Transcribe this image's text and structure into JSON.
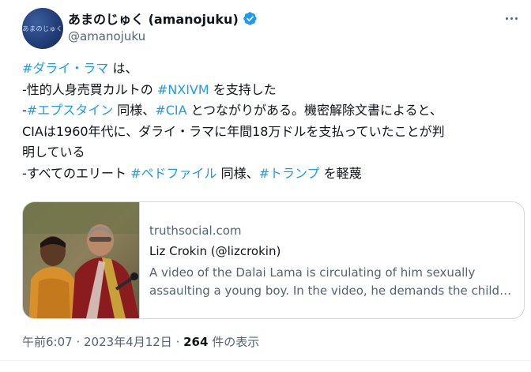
{
  "author": {
    "display_name": "あまのじゅく (amanojuku)",
    "handle": "@amanojuku",
    "avatar_text": "あまのじゅく",
    "verified": true
  },
  "tweet": {
    "lines": [
      [
        {
          "t": "#ダライ・ラマ",
          "link": true
        },
        {
          "t": " は、",
          "link": false
        }
      ],
      [
        {
          "t": "-性的人身売買カルトの ",
          "link": false
        },
        {
          "t": "#NXIVM",
          "link": true
        },
        {
          "t": " を支持した",
          "link": false
        }
      ],
      [
        {
          "t": "-",
          "link": false
        },
        {
          "t": "#エプスタイン",
          "link": true
        },
        {
          "t": " 同様、",
          "link": false
        },
        {
          "t": "#CIA",
          "link": true
        },
        {
          "t": " とつながりがある。機密解除文書によると、",
          "link": false
        }
      ],
      [
        {
          "t": "CIAは1960年代に、ダライ・ラマに年間18万ドルを支払っていたことが判",
          "link": false
        }
      ],
      [
        {
          "t": "明している",
          "link": false
        }
      ],
      [
        {
          "t": "-すべてのエリート ",
          "link": false
        },
        {
          "t": "#ペドファイル",
          "link": true
        },
        {
          "t": " 同様、",
          "link": false
        },
        {
          "t": "#トランプ",
          "link": true
        },
        {
          "t": " を軽蔑",
          "link": false
        }
      ]
    ]
  },
  "card": {
    "domain": "truthsocial.com",
    "title": "Liz Crokin (@lizcrokin)",
    "desc_line1": "A video of the Dalai Lama is circulating of him sexually",
    "desc_line2": "assaulting a young boy. In the video, he demands the child t..."
  },
  "meta": {
    "time": "午前6:07",
    "separator": " · ",
    "date": "2023年4月12日",
    "views_count": "264",
    "views_label": " 件の表示"
  },
  "colors": {
    "link": "#1d9bf0",
    "text": "#0f1419",
    "secondary": "#536471",
    "border": "#cfd9de"
  }
}
